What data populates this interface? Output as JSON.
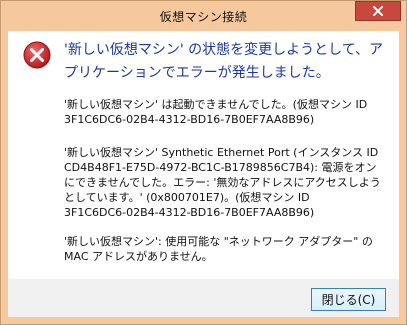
{
  "window": {
    "title": "仮想マシン接続",
    "close_button": "×"
  },
  "dialog": {
    "headline": "'新しい仮想マシン' の状態を変更しようとして、アプリケーションでエラーが発生しました。",
    "details": [
      "'新しい仮想マシン' は起動できませんでした。(仮想マシン ID\n3F1C6DC6-02B4-4312-BD16-7B0EF7AA8B96)",
      "'新しい仮想マシン' Synthetic Ethernet Port (インスタンス ID\nCD4B48F1-E75D-4972-BC1C-B1789856C7B4): 電源をオンにできませんでした。エラー: '無効なアドレスにアクセスしようとしています。' (0x800701E7)。(仮想マシン ID\n3F1C6DC6-02B4-4312-BD16-7B0EF7AA8B96)",
      "'新しい仮想マシン': 使用可能な \"ネットワーク アダプター\" の MAC アドレスがありません。"
    ],
    "button_label": "閉じる(C)"
  },
  "colors": {
    "frame": "#f5c99d",
    "headline": "#1a3a9e",
    "close_red": "#c7483e",
    "error_icon": "#d13438"
  },
  "icons": {
    "error": "error-icon",
    "close": "close-icon"
  }
}
